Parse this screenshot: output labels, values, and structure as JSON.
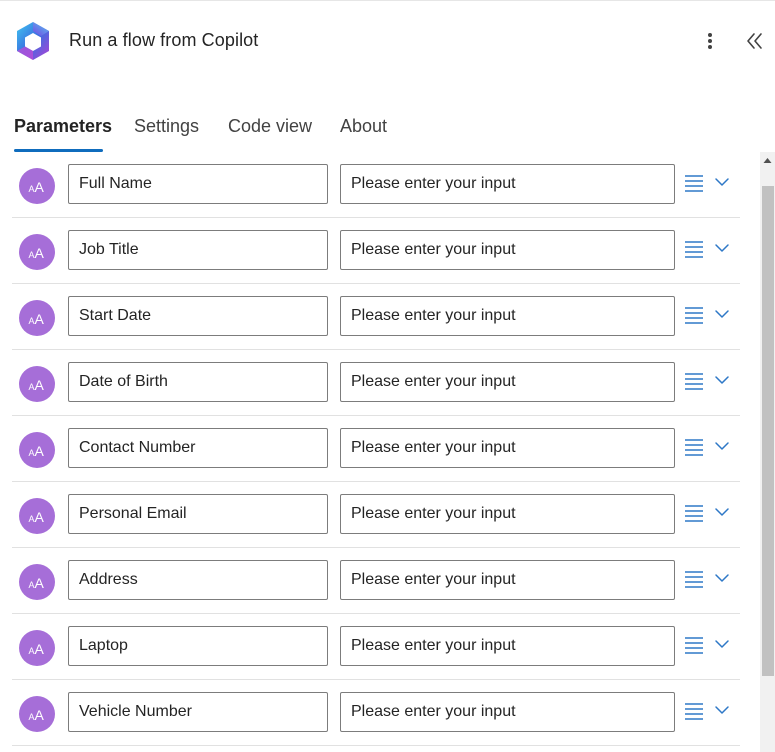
{
  "header": {
    "title": "Run a flow from Copilot"
  },
  "tabs": [
    {
      "label": "Parameters",
      "active": true
    },
    {
      "label": "Settings",
      "active": false
    },
    {
      "label": "Code view",
      "active": false
    },
    {
      "label": "About",
      "active": false
    }
  ],
  "parameters": {
    "placeholder": "Please enter your input",
    "avatar_icon": "text-type-icon",
    "rows": [
      {
        "name": "Full Name"
      },
      {
        "name": "Job Title"
      },
      {
        "name": "Start Date"
      },
      {
        "name": "Date of Birth"
      },
      {
        "name": "Contact Number"
      },
      {
        "name": "Personal Email"
      },
      {
        "name": "Address"
      },
      {
        "name": "Laptop"
      },
      {
        "name": "Vehicle Number"
      }
    ]
  },
  "colors": {
    "accent": "#0f6cbd",
    "avatar": "#a66ed8",
    "icon_blue": "#2e78c7"
  }
}
